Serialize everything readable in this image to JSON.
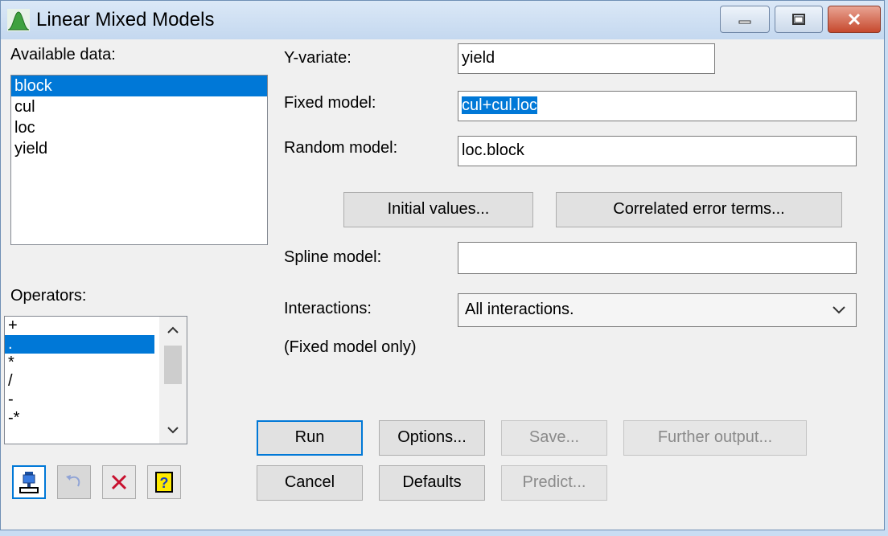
{
  "window": {
    "title": "Linear Mixed Models"
  },
  "available_data": {
    "label": "Available data:",
    "items": [
      "block",
      "cul",
      "loc",
      "yield"
    ],
    "selected_index": 0
  },
  "fields": {
    "y_variate": {
      "label": "Y-variate:",
      "value": "yield"
    },
    "fixed_model": {
      "label": "Fixed model:",
      "value": "cul+cul.loc"
    },
    "random_model": {
      "label": "Random model:",
      "value": "loc.block"
    },
    "spline_model": {
      "label": "Spline model:",
      "value": ""
    }
  },
  "buttons": {
    "initial_values": "Initial values...",
    "correlated_error_terms": "Correlated error terms...",
    "run": "Run",
    "options": "Options...",
    "save": "Save...",
    "further_output": "Further output...",
    "cancel": "Cancel",
    "defaults": "Defaults",
    "predict": "Predict..."
  },
  "interactions": {
    "label": "Interactions:",
    "value": "All interactions.",
    "note": "(Fixed model only)"
  },
  "operators": {
    "label": "Operators:",
    "items": [
      "+",
      ".",
      "*",
      "/",
      "-",
      "-*"
    ],
    "selected_index": 1
  },
  "colors": {
    "selection": "#0078d7",
    "close_button": "#c6492e"
  }
}
